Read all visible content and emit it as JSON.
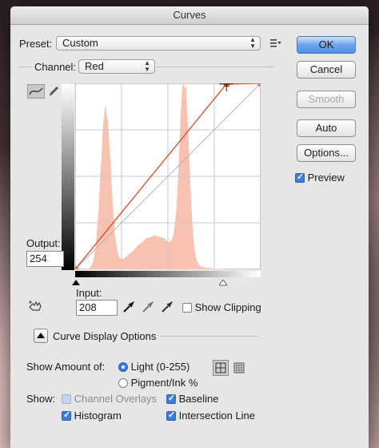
{
  "window": {
    "title": "Curves"
  },
  "preset": {
    "label": "Preset:",
    "value": "Custom"
  },
  "channel": {
    "label": "Channel:",
    "value": "Red"
  },
  "output": {
    "label": "Output:",
    "value": "254"
  },
  "input": {
    "label": "Input:",
    "value": "208"
  },
  "buttons": {
    "ok": "OK",
    "cancel": "Cancel",
    "smooth": "Smooth",
    "auto": "Auto",
    "options": "Options..."
  },
  "preview": {
    "label": "Preview",
    "checked": true
  },
  "show_clipping": {
    "label": "Show Clipping",
    "checked": false
  },
  "curve_display": {
    "label": "Curve Display Options"
  },
  "show_amount": {
    "label": "Show Amount of:",
    "options": [
      "Light  (0-255)",
      "Pigment/Ink %"
    ],
    "selected": "Light  (0-255)"
  },
  "show": {
    "label": "Show:",
    "channel_overlays": "Channel Overlays",
    "baseline": "Baseline",
    "histogram": "Histogram",
    "intersection_line": "Intersection Line"
  },
  "colors": {
    "curve": "#d9481f",
    "histogram": "#f7c3b0",
    "accent": "#3c7be0"
  },
  "curve_points": [
    {
      "input": 0,
      "output": 0
    },
    {
      "input": 208,
      "output": 254
    },
    {
      "input": 255,
      "output": 255
    }
  ],
  "histogram": {
    "peaks": [
      {
        "center": 42,
        "height": 0.86,
        "width": 10
      },
      {
        "center": 150,
        "height": 0.99,
        "width": 9
      },
      {
        "center": 110,
        "height": 0.18,
        "width": 40
      }
    ]
  }
}
